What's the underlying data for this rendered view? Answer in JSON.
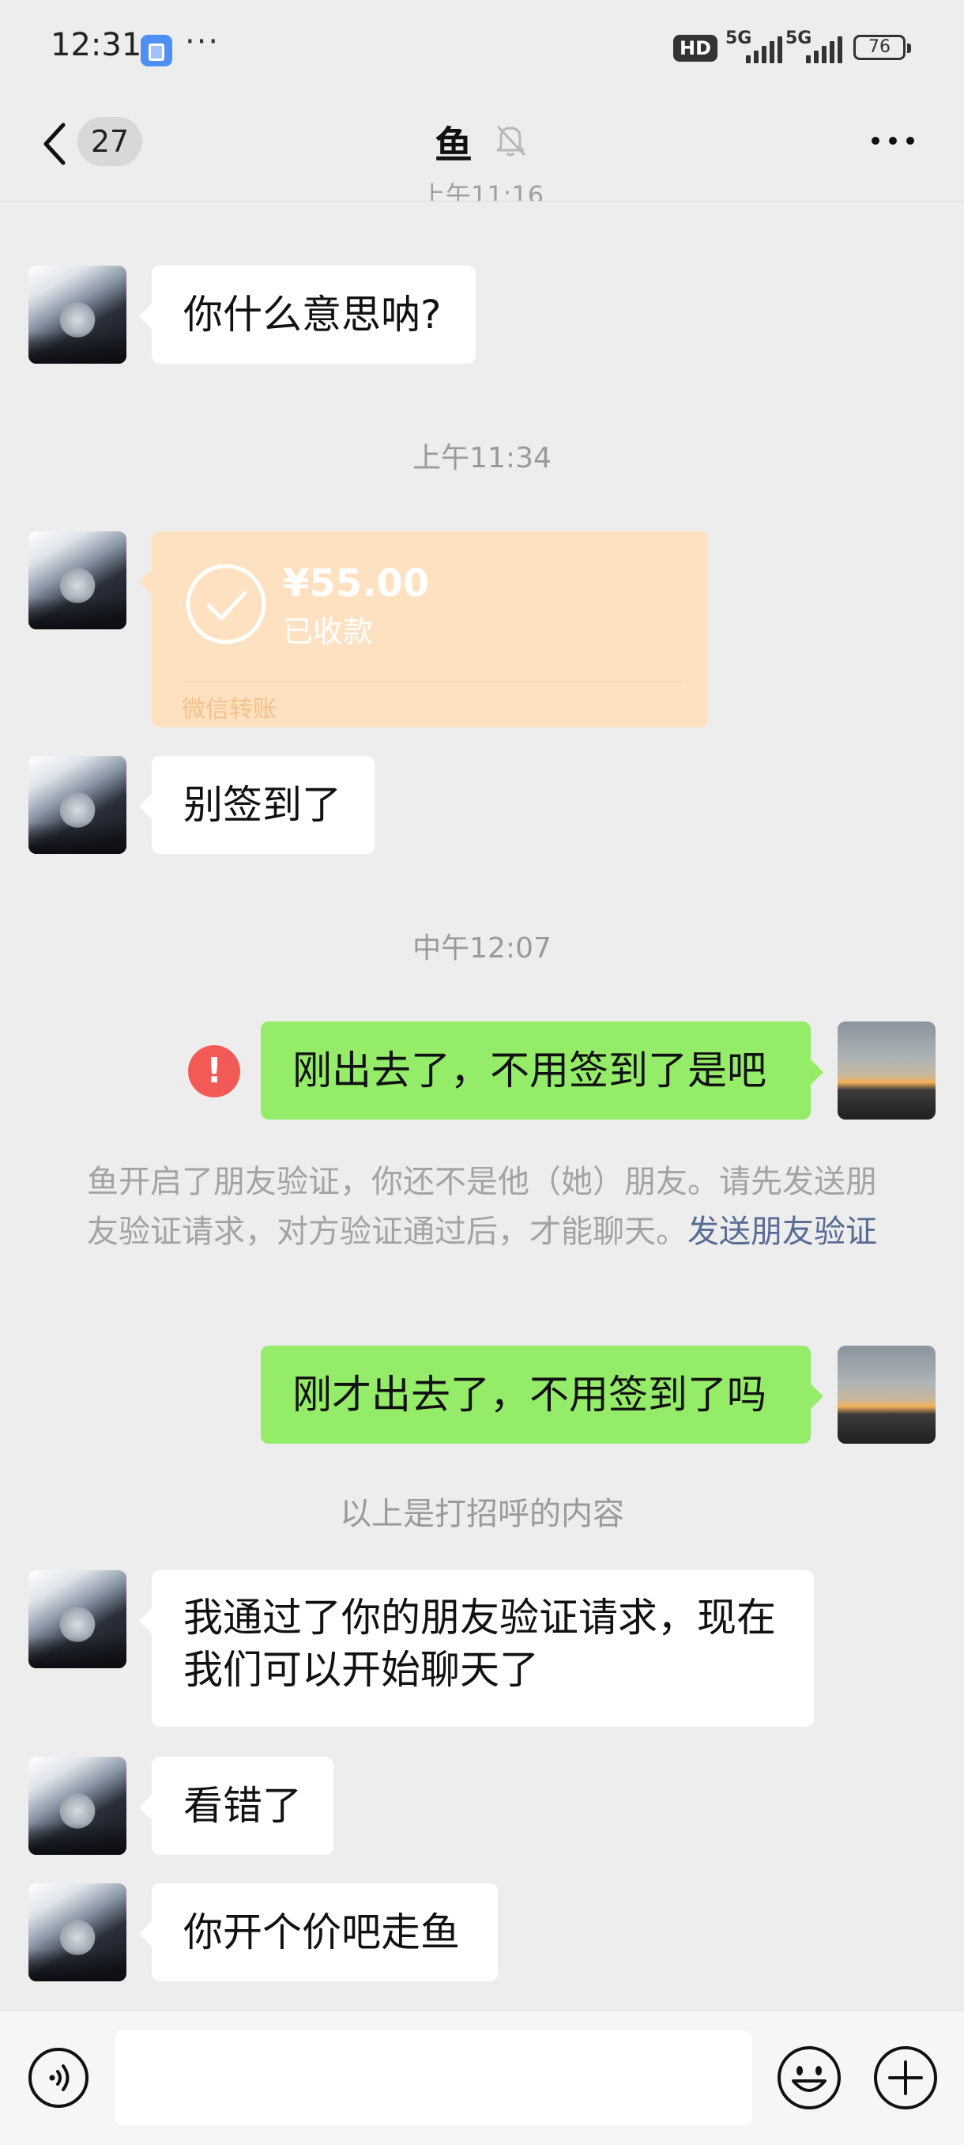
{
  "status_bar": {
    "time": "12:31",
    "dots": "···",
    "hd_label": "HD",
    "network_1": "5G",
    "network_2": "5G",
    "battery": "76"
  },
  "header": {
    "unread_count": "27",
    "title": "鱼",
    "cut_timestamp": "上午11:16"
  },
  "messages": {
    "m1": "你什么意思呐?",
    "ts1": "上午11:34",
    "transfer": {
      "amount": "¥55.00",
      "status": "已收款",
      "footer": "微信转账"
    },
    "m2": "别签到了",
    "ts2": "中午12:07",
    "m3": "刚出去了，不用签到了是吧",
    "m3_error": "!",
    "notice_text": "鱼开启了朋友验证，你还不是他（她）朋友。请先发送朋友验证请求，对方验证通过后，才能聊天。",
    "notice_link": "发送朋友验证",
    "m4": "刚才出去了，不用签到了吗",
    "greeting_divider": "以上是打招呼的内容",
    "m5_line1": "我通过了你的朋友验证请求，现在",
    "m5_line2": "我们可以开始聊天了",
    "m6": "看错了",
    "m7": "你开个价吧走鱼"
  },
  "input": {
    "placeholder": ""
  },
  "colors": {
    "background": "#ededed",
    "incoming_bubble": "#ffffff",
    "outgoing_bubble": "#95ec69",
    "transfer_card": "#fde1c1",
    "error": "#f25a57",
    "link": "#576b95"
  },
  "icons": [
    "back-icon",
    "mute-bell-icon",
    "more-icon",
    "check-circle-icon",
    "error-icon",
    "voice-icon",
    "emoji-icon",
    "plus-icon"
  ]
}
